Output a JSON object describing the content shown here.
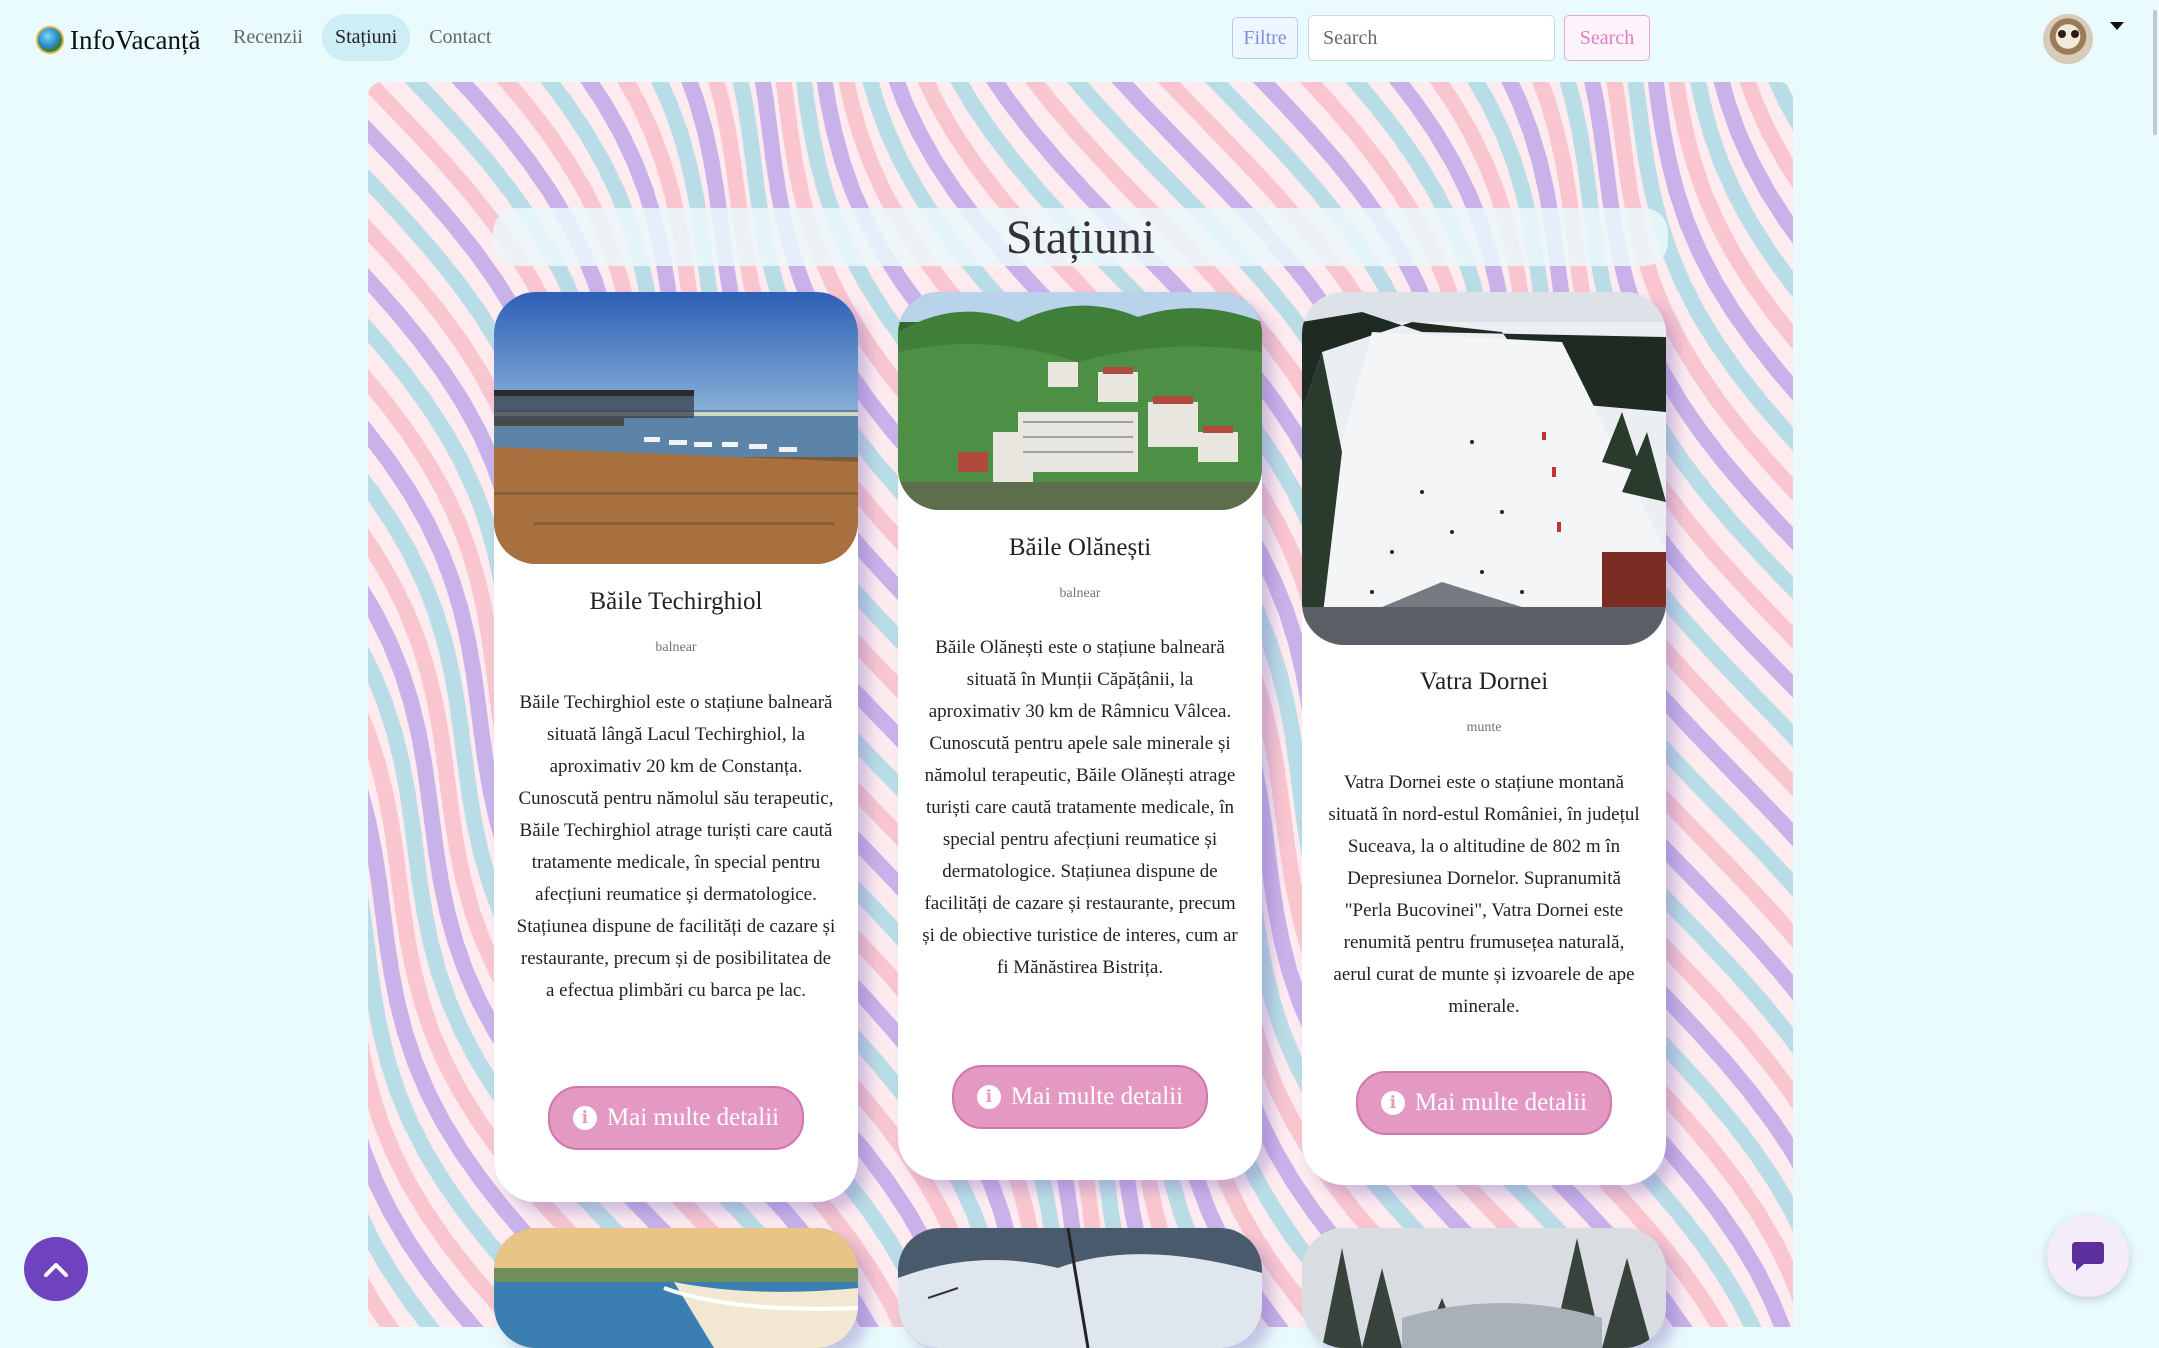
{
  "nav": {
    "brand": "InfoVacanță",
    "links": [
      "Recenzii",
      "Stațiuni",
      "Contact"
    ],
    "active_link": "Stațiuni",
    "filter_label": "Filtre",
    "search_placeholder": "Search",
    "search_button": "Search"
  },
  "page": {
    "title": "Stațiuni"
  },
  "cards": [
    {
      "title": "Băile Techirghiol",
      "category": "balnear",
      "description": "Băile Techirghiol este o stațiune balneară situată lângă Lacul Techirghiol, la aproximativ 20 km de Constanța. Cunoscută pentru nămolul său terapeutic, Băile Techirghiol atrage turiști care caută tratamente medicale, în special pentru afecțiuni reumatice și dermatologice. Stațiunea dispune de facilități de cazare și restaurante, precum și de posibilitatea de a efectua plimbări cu barca pe lac.",
      "button": "Mai multe detalii"
    },
    {
      "title": "Băile Olănești",
      "category": "balnear",
      "description": "Băile Olănești este o stațiune balneară situată în Munții Căpățânii, la aproximativ 30 km de Râmnicu Vâlcea. Cunoscută pentru apele sale minerale și nămolul terapeutic, Băile Olănești atrage turiști care caută tratamente medicale, în special pentru afecțiuni reumatice și dermatologice. Stațiunea dispune de facilități de cazare și restaurante, precum și de obiective turistice de interes, cum ar fi Mănăstirea Bistrița.",
      "button": "Mai multe detalii"
    },
    {
      "title": "Vatra Dornei",
      "category": "munte",
      "description": "Vatra Dornei este o stațiune montană situată în nord-estul României, în județul Suceava, la o altitudine de 802 m în Depresiunea Dornelor. Supranumită \"Perla Bucovinei\", Vatra Dornei este renumită pentru frumusețea naturală, aerul curat de munte și izvoarele de ape minerale.",
      "button": "Mai multe detalii"
    }
  ],
  "colors": {
    "background": "#e9fbfd",
    "accent_pink": "#e399c2",
    "back_to_top": "#6f43c0",
    "pattern": [
      "#f9c6cf",
      "#b9dde6",
      "#c9b2ea"
    ]
  },
  "icons": [
    "info-icon",
    "chevron-up-icon",
    "chat-icon",
    "user-avatar"
  ]
}
